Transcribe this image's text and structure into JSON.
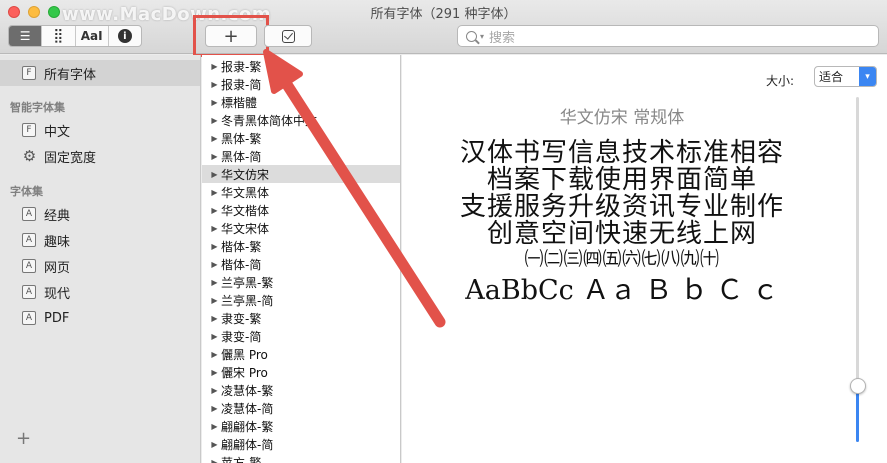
{
  "window": {
    "title": "所有字体（291 种字体）",
    "watermark": "www.MacDown.com"
  },
  "toolbar": {
    "view_modes": [
      {
        "icon": "list-icon",
        "label": "☰"
      },
      {
        "icon": "grid-icon",
        "label": "⣿"
      },
      {
        "icon": "text-preview-icon",
        "label": "AaI"
      },
      {
        "icon": "info-icon",
        "label": "i"
      }
    ],
    "add_label": "+",
    "validate_icon": "checkbox-icon",
    "search_placeholder": "搜索"
  },
  "sidebar": {
    "top_items": [
      {
        "label": "所有字体",
        "icon": "font-collection-icon",
        "selected": true
      }
    ],
    "smart_header": "智能字体集",
    "smart_items": [
      {
        "label": "中文",
        "icon": "font-collection-icon"
      },
      {
        "label": "固定宽度",
        "icon": "gear-icon"
      }
    ],
    "collections_header": "字体集",
    "collections": [
      {
        "label": "经典",
        "icon": "font-collection-icon"
      },
      {
        "label": "趣味",
        "icon": "font-collection-icon"
      },
      {
        "label": "网页",
        "icon": "font-collection-icon"
      },
      {
        "label": "现代",
        "icon": "font-collection-icon"
      },
      {
        "label": "PDF",
        "icon": "font-collection-icon"
      }
    ],
    "add_label": "+"
  },
  "font_list": {
    "selected_index": 6,
    "items": [
      "报隶-繁",
      "报隶-简",
      "標楷體",
      "冬青黑体简体中文",
      "黑体-繁",
      "黑体-简",
      "华文仿宋",
      "华文黑体",
      "华文楷体",
      "华文宋体",
      "楷体-繁",
      "楷体-简",
      "兰亭黑-繁",
      "兰亭黑-简",
      "隶变-繁",
      "隶变-简",
      "儷黑 Pro",
      "儷宋 Pro",
      "凌慧体-繁",
      "凌慧体-简",
      "翩翩体-繁",
      "翩翩体-简",
      "苹方-繁"
    ]
  },
  "preview": {
    "size_label": "大小:",
    "size_value": "适合",
    "font_name": "华文仿宋 常规体",
    "sample_lines": [
      "汉体书写信息技术标准相容",
      "档案下载使用界面简单",
      "支援服务升级资讯专业制作",
      "创意空间快速无线上网",
      "㈠㈡㈢㈣㈤㈥㈦㈧㈨㈩",
      "AaBbCc Ａａ Ｂ ｂ Ｃ ｃ"
    ],
    "slider_level": 0.16
  },
  "colors": {
    "accent": "#3b86f2",
    "annotation": "#e2524a",
    "selection": "#d3d3d3"
  }
}
